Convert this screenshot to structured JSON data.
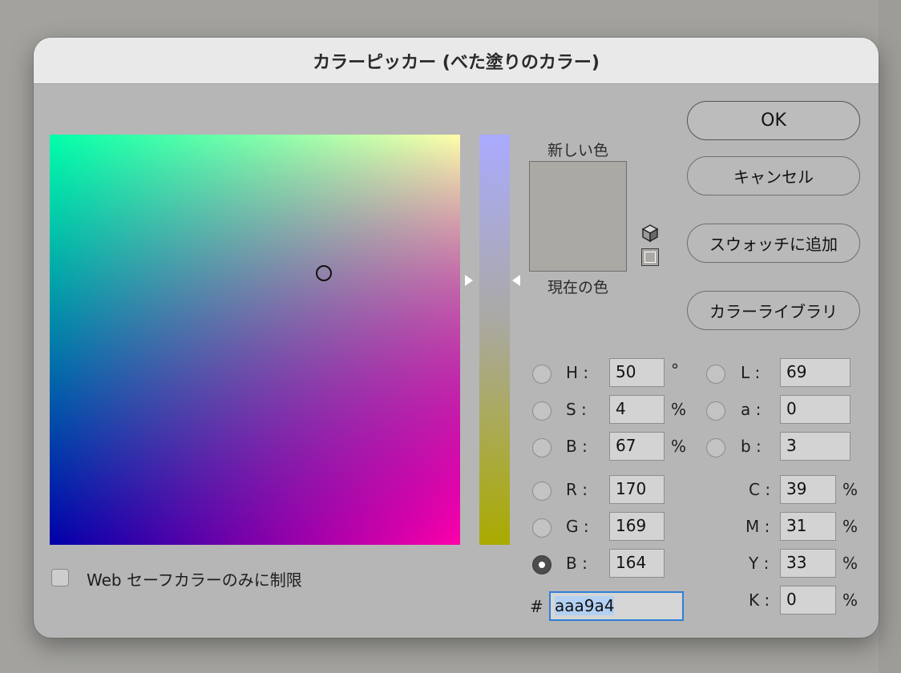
{
  "dialog": {
    "title": "カラーピッカー (べた塗りのカラー)"
  },
  "preview": {
    "new_label": "新しい色",
    "current_label": "現在の色",
    "color": "#aaa9a4"
  },
  "buttons": {
    "ok": "OK",
    "cancel": "キャンセル",
    "add_swatch": "スウォッチに追加",
    "color_libraries": "カラーライブラリ"
  },
  "fields": {
    "H": {
      "label": "H :",
      "value": "50",
      "unit": "°"
    },
    "S": {
      "label": "S :",
      "value": "4",
      "unit": "%"
    },
    "Bv": {
      "label": "B :",
      "value": "67",
      "unit": "%"
    },
    "R": {
      "label": "R :",
      "value": "170"
    },
    "G": {
      "label": "G :",
      "value": "169"
    },
    "Bc": {
      "label": "B :",
      "value": "164"
    },
    "L": {
      "label": "L :",
      "value": "69"
    },
    "a": {
      "label": "a :",
      "value": "0"
    },
    "b": {
      "label": "b :",
      "value": "3"
    },
    "C": {
      "label": "C :",
      "value": "39",
      "unit": "%"
    },
    "M": {
      "label": "M :",
      "value": "31",
      "unit": "%"
    },
    "Y": {
      "label": "Y :",
      "value": "33",
      "unit": "%"
    },
    "K": {
      "label": "K :",
      "value": "0",
      "unit": "%"
    }
  },
  "hex": {
    "prefix": "#",
    "value": "aaa9a4"
  },
  "websafe": {
    "label": "Web セーフカラーのみに制限",
    "checked": false
  },
  "selected_channel": "B (blue)",
  "picker": {
    "saturation_fraction": 0.667,
    "value_fraction": 0.337,
    "slider_fraction": 0.355
  },
  "colors": {
    "accent": "#2f7fd6",
    "dialog_bg": "#b6b6b6",
    "titlebar_bg": "#e9e9e9"
  }
}
